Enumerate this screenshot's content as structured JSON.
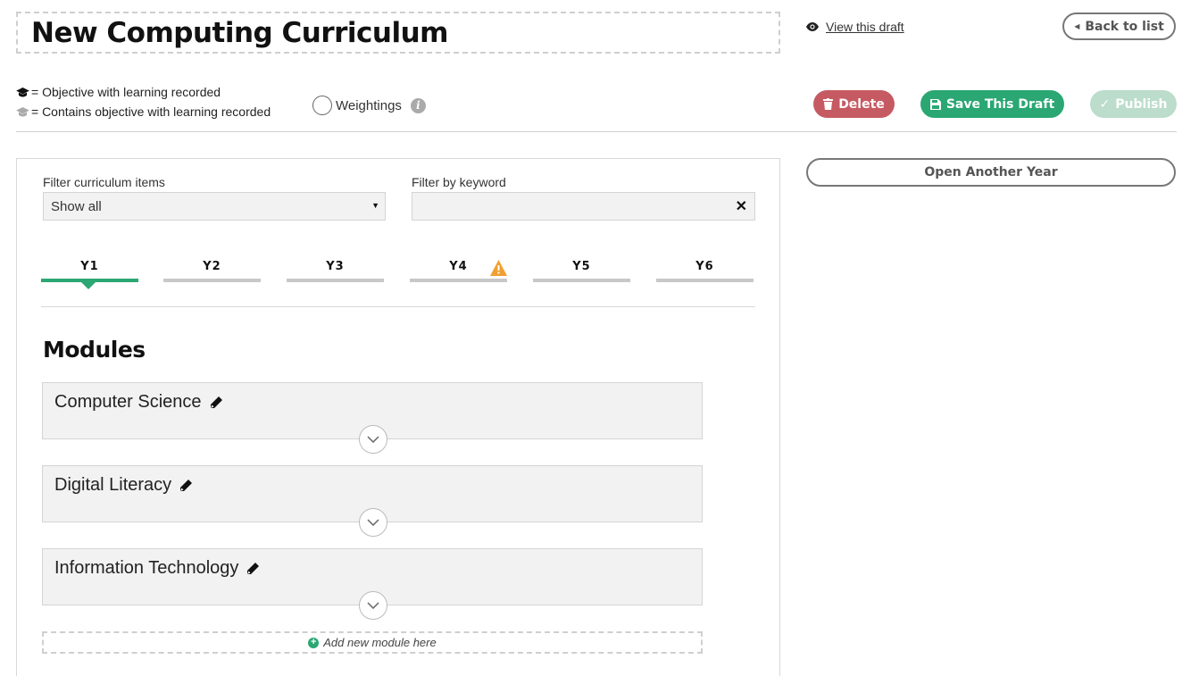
{
  "header": {
    "title": "New Computing Curriculum",
    "view_draft": "View this draft",
    "back": "Back to list"
  },
  "legend": {
    "objective": "= Objective with learning recorded",
    "contains": "= Contains objective with learning recorded"
  },
  "weightings": {
    "label": "Weightings",
    "checked": false
  },
  "actions": {
    "delete": "Delete",
    "save": "Save This Draft",
    "publish": "Publish"
  },
  "sidebar": {
    "open_year": "Open Another Year"
  },
  "filters": {
    "items_label": "Filter curriculum items",
    "items_value": "Show all",
    "keyword_label": "Filter by keyword",
    "keyword_value": ""
  },
  "tabs": [
    {
      "label": "Y1",
      "active": true
    },
    {
      "label": "Y2"
    },
    {
      "label": "Y3"
    },
    {
      "label": "Y4",
      "warning": true
    },
    {
      "label": "Y5"
    },
    {
      "label": "Y6"
    }
  ],
  "modules": {
    "heading": "Modules",
    "items": [
      {
        "title": "Computer Science"
      },
      {
        "title": "Digital Literacy"
      },
      {
        "title": "Information Technology"
      }
    ],
    "add_label": "Add new module here"
  },
  "colors": {
    "accent": "#2aa773",
    "delete": "#c65a62",
    "publish_disabled": "#bcdccc",
    "warning": "#f0a030"
  }
}
